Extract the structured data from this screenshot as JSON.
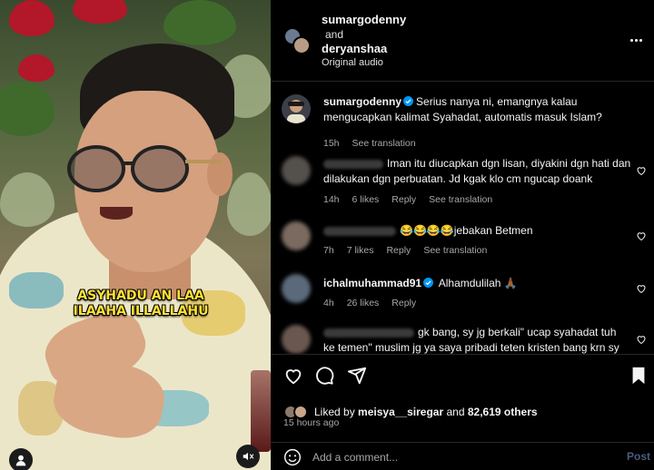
{
  "video": {
    "caption_line1": "ASYHADU AN LAA",
    "caption_line2": "ILAAHA ILLALLAHU"
  },
  "header": {
    "user1": "sumargodenny",
    "joiner": "and",
    "user2": "deryanshaa",
    "audio": "Original audio"
  },
  "caption_comment": {
    "username": "sumargodenny",
    "text": "Serius nanya ni, emangnya kalau mengucapkan kalimat Syahadat, automatis masuk Islam?",
    "time": "15h",
    "translate": "See translation"
  },
  "comments": [
    {
      "text": "Iman itu diucapkan dgn lisan, diyakini dgn hati dan dilakukan dgn perbuatan. Jd kgak klo cm ngucap doank",
      "time": "14h",
      "likes": "6 likes",
      "reply": "Reply",
      "translate": "See translation"
    },
    {
      "emojis": "😂😂😂😂",
      "text": "jebakan Betmen",
      "time": "7h",
      "likes": "7 likes",
      "reply": "Reply",
      "translate": "See translation"
    },
    {
      "username": "ichalmuhammad91",
      "text": "Alhamdulilah",
      "emoji": "🙏🏾",
      "time": "4h",
      "likes": "26 likes",
      "reply": "Reply"
    },
    {
      "text_line1": "gk bang, sy jg berkali\" ucap syahadat tuh",
      "text_line2": "ke temen\" muslim jg ya saya pribadi teten kristen bang krn sy"
    }
  ],
  "likes": {
    "prefix": "Liked by",
    "user": "meisya__siregar",
    "joiner": "and",
    "others": "82,619 others",
    "time": "15 hours ago"
  },
  "add_comment": {
    "placeholder": "Add a comment...",
    "post_label": "Post"
  },
  "colors": {
    "accent_blue": "#0095f6",
    "caption_yellow": "#ffe233",
    "muted_text": "#a8a8a8"
  }
}
